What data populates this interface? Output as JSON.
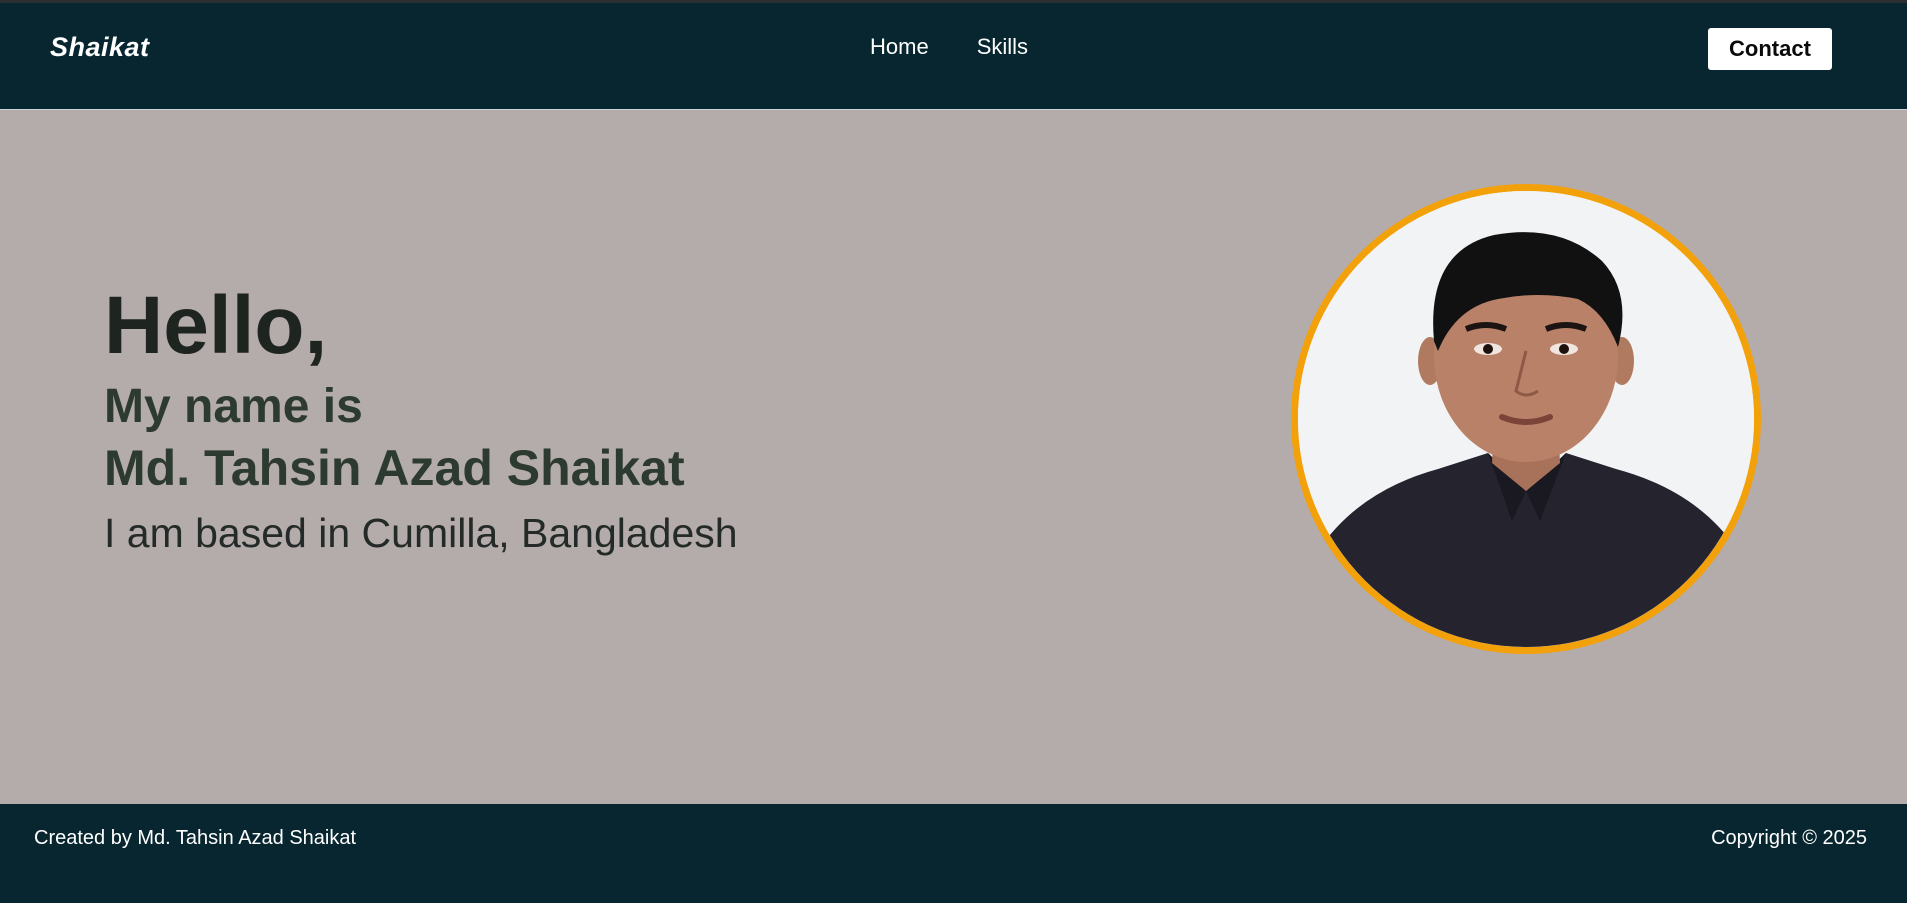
{
  "header": {
    "logo": "Shaikat",
    "nav": [
      "Home",
      "Skills"
    ],
    "contact_label": "Contact"
  },
  "hero": {
    "greeting": "Hello,",
    "intro": "My name is",
    "name": "Md. Tahsin Azad Shaikat",
    "location": "I am based in Cumilla, Bangladesh"
  },
  "colors": {
    "header_bg": "#08262f",
    "hero_bg": "#b4abab",
    "portrait_ring": "#f3a10b"
  },
  "footer": {
    "credit": "Created by Md. Tahsin Azad Shaikat",
    "copyright": "Copyright © 2025"
  }
}
